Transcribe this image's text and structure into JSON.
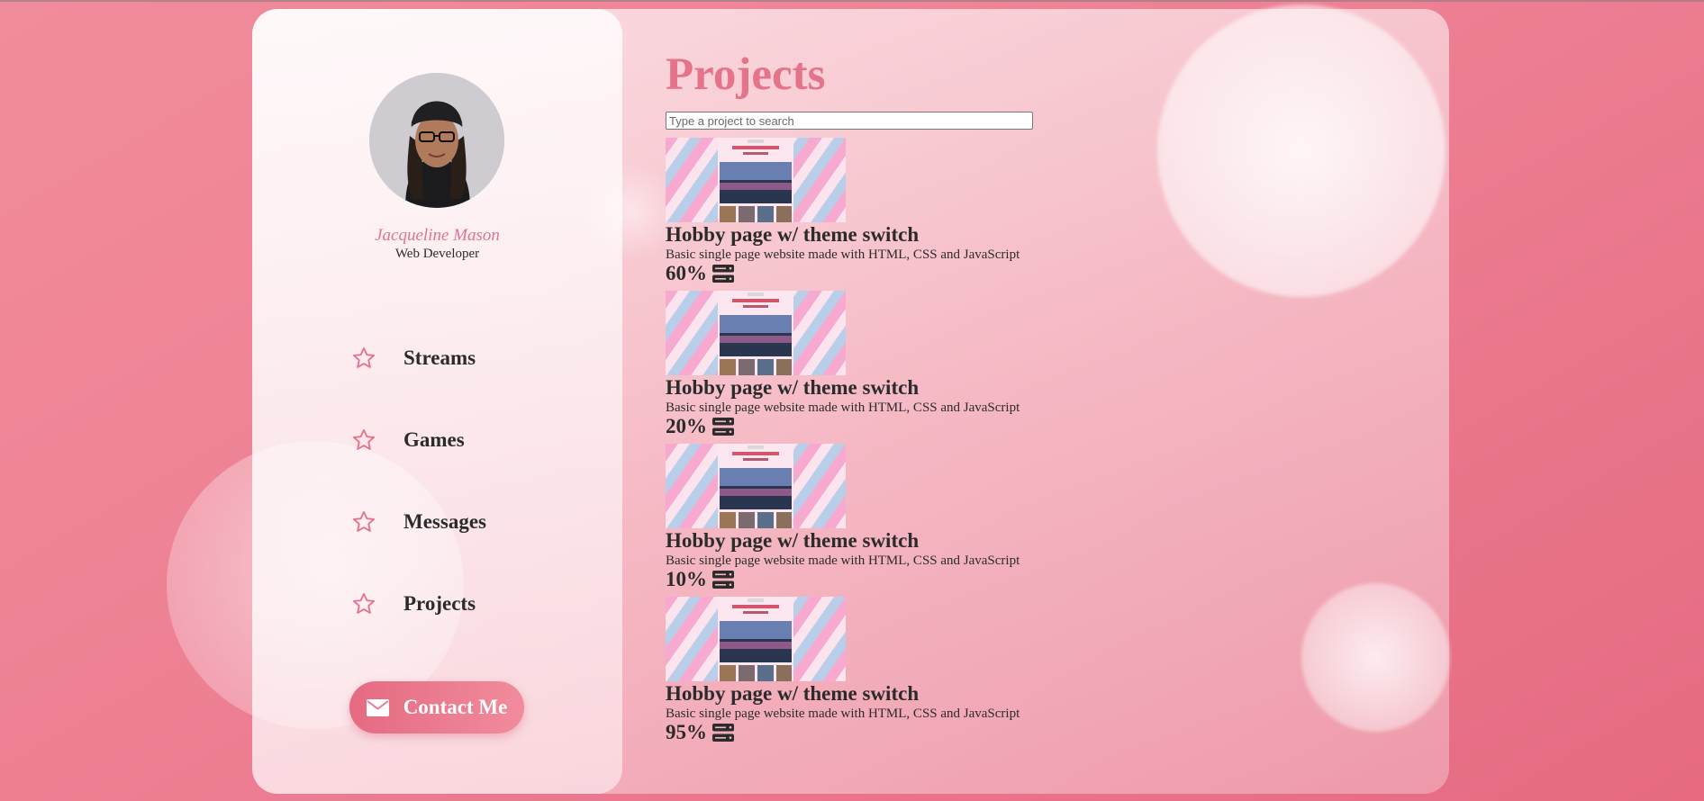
{
  "profile": {
    "name": "Jacqueline Mason",
    "role": "Web Developer"
  },
  "sidebar": {
    "items": [
      {
        "label": "Streams",
        "icon": "star-icon"
      },
      {
        "label": "Games",
        "icon": "star-icon"
      },
      {
        "label": "Messages",
        "icon": "star-icon"
      },
      {
        "label": "Projects",
        "icon": "star-icon"
      }
    ],
    "contact_label": "Contact Me",
    "contact_icon": "envelope-icon"
  },
  "main": {
    "title": "Projects",
    "search_placeholder": "Type a project to search",
    "projects": [
      {
        "title": "Hobby page w/ theme switch",
        "description": "Basic single page website made with HTML, CSS and JavaScript",
        "progress": "60%",
        "icon": "server-icon"
      },
      {
        "title": "Hobby page w/ theme switch",
        "description": "Basic single page website made with HTML, CSS and JavaScript",
        "progress": "20%",
        "icon": "server-icon"
      },
      {
        "title": "Hobby page w/ theme switch",
        "description": "Basic single page website made with HTML, CSS and JavaScript",
        "progress": "10%",
        "icon": "server-icon"
      },
      {
        "title": "Hobby page w/ theme switch",
        "description": "Basic single page website made with HTML, CSS and JavaScript",
        "progress": "95%",
        "icon": "server-icon"
      }
    ]
  },
  "colors": {
    "accent": "#e5738a",
    "background": "#ee8094",
    "text": "#2b2b2b"
  }
}
